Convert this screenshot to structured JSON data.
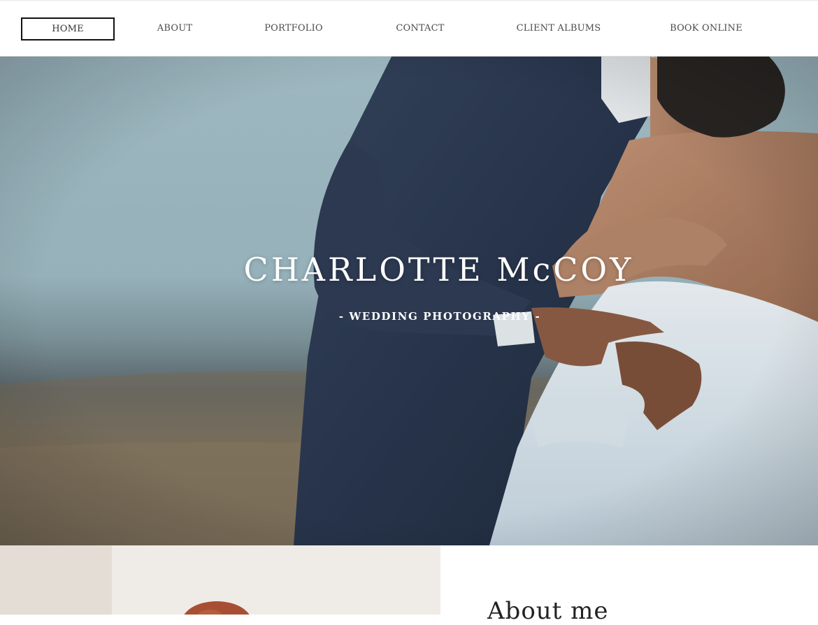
{
  "nav": {
    "items": [
      {
        "label": "HOME",
        "active": true
      },
      {
        "label": "ABOUT",
        "active": false
      },
      {
        "label": "PORTFOLIO",
        "active": false
      },
      {
        "label": "CONTACT",
        "active": false
      },
      {
        "label": "CLIENT ALBUMS",
        "active": false
      },
      {
        "label": "BOOK ONLINE",
        "active": false
      }
    ]
  },
  "hero": {
    "title": "CHARLOTTE McCOY",
    "subtitle": "- WEDDING PHOTOGRAPHY -"
  },
  "about": {
    "heading": "About me"
  },
  "colors": {
    "nav_text": "#4a4a4a",
    "nav_active_border": "#111111",
    "hero_text": "#ffffff",
    "suit": "#2b3850",
    "dress": "#e4edf3"
  }
}
